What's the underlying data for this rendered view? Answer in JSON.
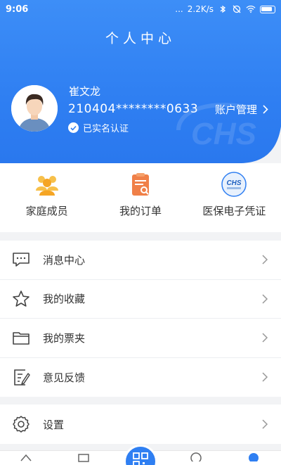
{
  "status_bar": {
    "time": "9:06",
    "speed": "2.2K/s",
    "dots": "..."
  },
  "header": {
    "title": "个人中心",
    "user_name": "崔文龙",
    "user_id": "210404********0633",
    "verified_label": "已实名认证",
    "account_mgmt_label": "账户管理",
    "watermark_text": "CHS"
  },
  "quick_actions": [
    {
      "label": "家庭成员",
      "icon": "family-icon"
    },
    {
      "label": "我的订单",
      "icon": "order-icon"
    },
    {
      "label": "医保电子凭证",
      "icon": "chs-icon"
    }
  ],
  "menu": [
    {
      "label": "消息中心",
      "icon": "message-icon"
    },
    {
      "label": "我的收藏",
      "icon": "star-icon"
    },
    {
      "label": "我的票夹",
      "icon": "folder-icon"
    },
    {
      "label": "意见反馈",
      "icon": "feedback-icon"
    }
  ],
  "settings": {
    "label": "设置",
    "icon": "gear-icon"
  },
  "colors": {
    "primary": "#2f7ff2",
    "orange": "#f5a524",
    "background": "#f2f3f5"
  }
}
